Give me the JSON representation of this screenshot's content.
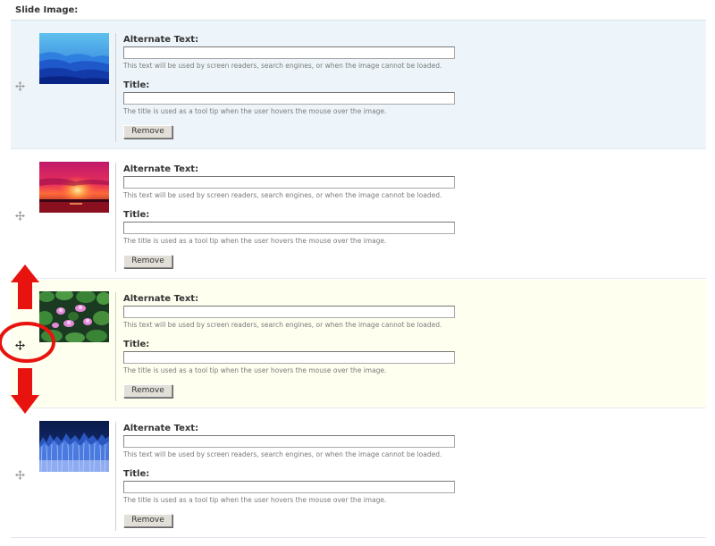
{
  "field": {
    "label": "Slide Image:"
  },
  "rows": [
    {
      "thumb": "blue-mountains-image",
      "alt": {
        "label": "Alternate Text:",
        "value": "",
        "description": "This text will be used by screen readers, search engines, or when the image cannot be loaded."
      },
      "title": {
        "label": "Title:",
        "value": "",
        "description": "The title is used as a tool tip when the user hovers the mouse over the image."
      },
      "remove_label": "Remove"
    },
    {
      "thumb": "sunset-image",
      "alt": {
        "label": "Alternate Text:",
        "value": "",
        "description": "This text will be used by screen readers, search engines, or when the image cannot be loaded."
      },
      "title": {
        "label": "Title:",
        "value": "",
        "description": "The title is used as a tool tip when the user hovers the mouse over the image."
      },
      "remove_label": "Remove"
    },
    {
      "thumb": "water-lilies-image",
      "alt": {
        "label": "Alternate Text:",
        "value": "",
        "description": "This text will be used by screen readers, search engines, or when the image cannot be loaded."
      },
      "title": {
        "label": "Title:",
        "value": "",
        "description": "The title is used as a tool tip when the user hovers the mouse over the image."
      },
      "remove_label": "Remove"
    },
    {
      "thumb": "winter-trees-image",
      "alt": {
        "label": "Alternate Text:",
        "value": "",
        "description": "This text will be used by screen readers, search engines, or when the image cannot be loaded."
      },
      "title": {
        "label": "Title:",
        "value": "",
        "description": "The title is used as a tool tip when the user hovers the mouse over the image."
      },
      "remove_label": "Remove"
    }
  ],
  "annotation": {
    "color": "#e8130e",
    "icons": [
      "red-up-arrow-icon",
      "red-circle-highlight",
      "red-down-arrow-icon"
    ]
  },
  "colors": {
    "row_highlight_blue": "#edf5fa",
    "row_highlight_yellow": "#fffff0"
  }
}
